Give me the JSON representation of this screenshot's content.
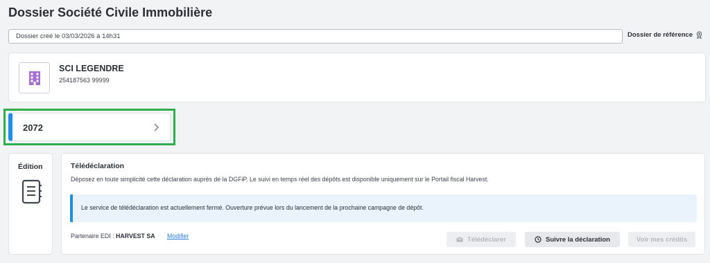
{
  "page": {
    "title": "Dossier Société Civile Immobilière",
    "created_value": "Dossier créé le 03/03/2026 à 14h31",
    "reference_label": "Dossier de référence"
  },
  "company": {
    "name": "SCI LEGENDRE",
    "siret": "254187563 99999"
  },
  "form_selector": {
    "label": "2072"
  },
  "edition": {
    "title": "Édition"
  },
  "teledeclaration": {
    "title": "Télédéclaration",
    "description": "Déposez en toute simplicité cette déclaration auprès de la DGFiP. Le suivi en temps réel des dépôts est disponible uniquement sur le Portail fiscal Harvest.",
    "alert": "Le service de télédéclaration est actuellement fermé. Ouverture prévue lors du lancement de la prochaine campagne de dépôt.",
    "partner_label": "Partenaire EDI :",
    "partner_name": "HARVEST SA",
    "modify_link": "Modifier",
    "buttons": {
      "teledeclarer": "Télédéclarer",
      "suivre": "Suivre la déclaration",
      "credits": "Voir mes crédits"
    }
  },
  "colors": {
    "accent": "#1e8ee4",
    "highlight": "#2eae4a",
    "logo_purple": "#a56fd0"
  },
  "icons": {
    "reference": "award-badge-icon",
    "company": "building-icon",
    "chevron": "chevron-right-icon",
    "edition": "notebook-icon",
    "teledeclarer": "envelope-icon",
    "suivre": "clock-icon"
  }
}
